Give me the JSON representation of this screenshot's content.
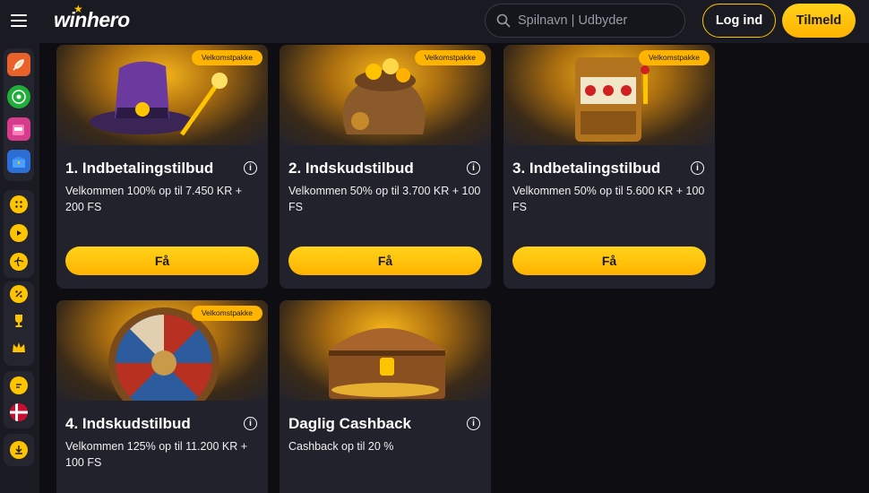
{
  "header": {
    "logo": "winhero",
    "search_placeholder": "Spilnavn | Udbyder",
    "login_label": "Log ind",
    "signup_label": "Tilmeld"
  },
  "sidebar": {
    "icons": [
      "rocket-icon",
      "roulette-icon",
      "slot-machine-icon",
      "treasure-chest-icon",
      "dice-icon",
      "live-casino-icon",
      "sports-ball-icon",
      "promotions-icon",
      "trophy-icon",
      "vip-crown-icon",
      "chat-icon",
      "danish-flag-icon",
      "download-icon"
    ]
  },
  "cards": [
    {
      "badge": "Velkomstpakke",
      "title": "1. Indbetalingstilbud",
      "desc": "Velkommen 100% op til 7.450 KR + 200 FS",
      "button": "Få",
      "image": "wizard-hat"
    },
    {
      "badge": "Velkomstpakke",
      "title": "2. Indskudstilbud",
      "desc": "Velkommen 50% op til 3.700 KR + 100 FS",
      "button": "Få",
      "image": "coin-bag"
    },
    {
      "badge": "Velkomstpakke",
      "title": "3. Indbetalingstilbud",
      "desc": "Velkommen 50% op til 5.600 KR + 100 FS",
      "button": "Få",
      "image": "slot-machine"
    },
    {
      "badge": "Velkomstpakke",
      "title": "4. Indskudstilbud",
      "desc": "Velkommen 125% op til 11.200 KR + 100 FS",
      "button": "",
      "image": "fortune-wheel"
    },
    {
      "badge": "",
      "title": "Daglig Cashback",
      "desc": "Cashback op til 20 %",
      "button": "",
      "image": "treasure-chest"
    }
  ],
  "colors": {
    "accent": "#ffc400",
    "card_bg": "#22222c",
    "header_bg": "#1a1a22"
  }
}
